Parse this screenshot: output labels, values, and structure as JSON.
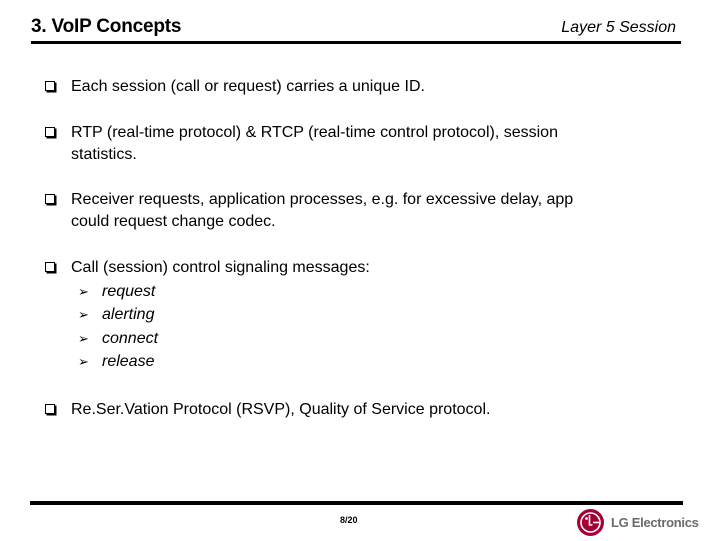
{
  "header": {
    "title": "3. VoIP Concepts",
    "subtitle": "Layer 5 Session"
  },
  "bullets": [
    {
      "icon": "checkbox-bullet-icon",
      "lines": [
        "Each session (call or request) carries a unique ID."
      ]
    },
    {
      "icon": "checkbox-bullet-icon",
      "lines": [
        "RTP (real-time protocol) & RTCP (real-time control protocol), session",
        "statistics."
      ]
    },
    {
      "icon": "checkbox-bullet-icon",
      "lines": [
        "Receiver requests, application processes, e.g. for excessive delay, app",
        "could request change codec."
      ]
    },
    {
      "icon": "checkbox-bullet-icon",
      "lines": [
        "Call (session) control signaling messages:"
      ],
      "subitems": [
        {
          "icon": "arrow-bullet-icon",
          "glyph": "➢",
          "text": "request"
        },
        {
          "icon": "arrow-bullet-icon",
          "glyph": "➢",
          "text": "alerting"
        },
        {
          "icon": "arrow-bullet-icon",
          "glyph": "➢",
          "text": "connect"
        },
        {
          "icon": "arrow-bullet-icon",
          "glyph": "➢",
          "text": "release"
        }
      ]
    },
    {
      "icon": "checkbox-bullet-icon",
      "lines": [
        "Re.Ser.Vation Protocol (RSVP), Quality of Service protocol."
      ]
    }
  ],
  "footer": {
    "page_number": "8/20",
    "brand": "LG Electronics",
    "brand_color": "#a50034"
  }
}
